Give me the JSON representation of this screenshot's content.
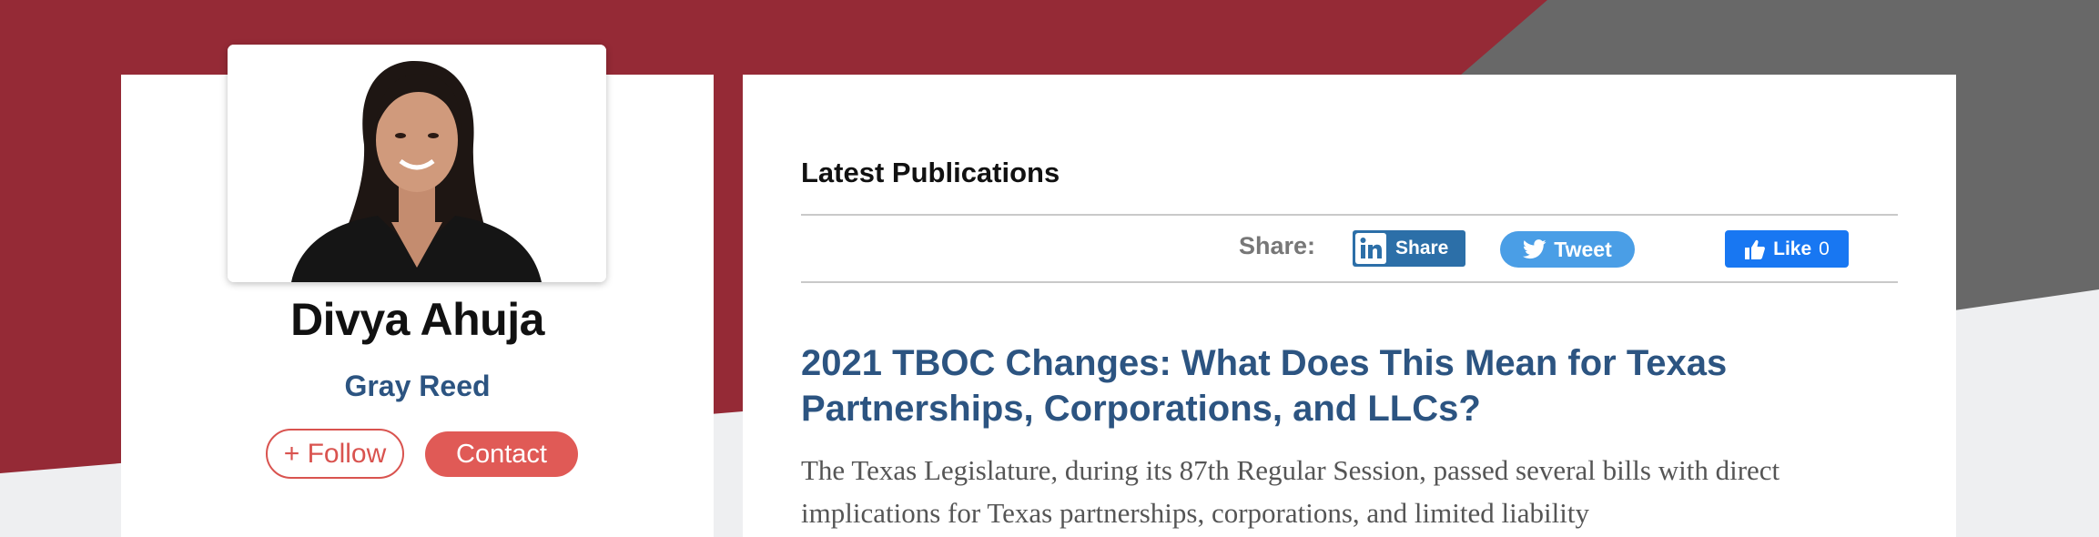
{
  "author": {
    "name": "Divya Ahuja",
    "firm": "Gray Reed",
    "follow_label": "+ Follow",
    "contact_label": "Contact"
  },
  "publications": {
    "section_title": "Latest Publications",
    "share_label": "Share:",
    "linkedin_label": "Share",
    "tweet_label": "Tweet",
    "like_label": "Like",
    "like_count": "0",
    "article_title": "2021 TBOC Changes: What Does This Mean for Texas Partnerships, Corporations, and LLCs?",
    "article_excerpt": "The Texas Legislature, during its 87th Regular Session, passed several bills with direct implications for Texas partnerships, corporations, and limited liability"
  },
  "colors": {
    "brand_red": "#952a36",
    "gray_band": "#686868",
    "link_blue": "#2c5481",
    "button_red": "#e05a56",
    "linkedin": "#2c6fa8",
    "twitter": "#4a9ee6",
    "facebook": "#1877f2"
  },
  "icons": [
    "linkedin-icon",
    "twitter-bird-icon",
    "thumbs-up-icon"
  ]
}
